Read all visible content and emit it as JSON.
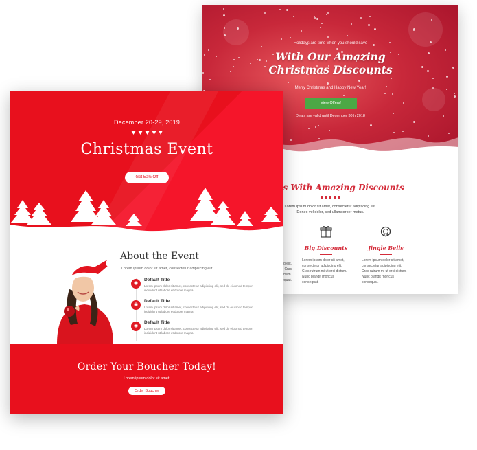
{
  "back": {
    "hero": {
      "kicker": "Holidays are time when you should save",
      "headline_1": "With Our Amazing",
      "headline_2": "Christmas Discounts",
      "greeting": "Merry Christmas and Happy New Year!",
      "cta_label": "View Offers!",
      "validity": "Deals are valid until December 30th 2018"
    },
    "gifts": {
      "title": "g Gifts With Amazing Discounts",
      "subtitle_1": "Lorem ipsum dolor sit amet, consectetur adipiscing elit.",
      "subtitle_2": "Donec vel dolor, sed ullamcorper metus."
    },
    "features": [
      {
        "icon": "gift-icon",
        "title": "Big Discounts",
        "text": "Lorem ipsum dolor sit amet, consectetur adipiscing elit. Cras rutrum mi ut orci dictum. Nunc blandit rhoncus consequat."
      },
      {
        "icon": "wreath-icon",
        "title": "Jingle Bells",
        "text": "Lorem ipsum dolor sit amet, consectetur adipiscing elit. Cras rutrum mi ut orci dictum. Nunc blandit rhoncus consequat."
      }
    ],
    "left_partial_text": "ng elit.\nCras\ndictum.\nequat."
  },
  "front": {
    "hero": {
      "date": "December 20-29, 2019",
      "title": "Christmas Event",
      "cta_label": "Get 50% Off"
    },
    "about": {
      "title": "About the Event",
      "subtitle": "Lorem ipsum dolor sit amet, consectetur adipiscing elit.",
      "items": [
        {
          "title": "Default Title",
          "desc": "Lorem ipsum dolor sit amet, consectetur adipiscing elit, sed do eiusmod tempor incididunt ut labore et dolore magna"
        },
        {
          "title": "Default Title",
          "desc": "Lorem ipsum dolor sit amet, consectetur adipiscing elit, sed do eiusmod tempor incididunt ut labore et dolore magna"
        },
        {
          "title": "Default Title",
          "desc": "Lorem ipsum dolor sit amet, consectetur adipiscing elit, sed do eiusmod tempor incididunt ut labore et dolore magna"
        }
      ]
    },
    "footer": {
      "title": "Order Your Boucher Today!",
      "subtitle": "Lorem ipsum dolor sit amet.",
      "cta_label": "Order Boucher"
    }
  },
  "colors": {
    "brand_red": "#e8101d",
    "accent_red": "#d42c3a",
    "cta_green": "#4ca845"
  }
}
